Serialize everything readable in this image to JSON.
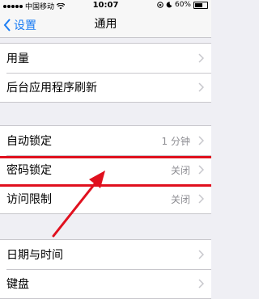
{
  "status_bar": {
    "carrier": "中国移动",
    "time": "10:07",
    "battery": "60%"
  },
  "nav": {
    "back_label": "设置",
    "title": "通用"
  },
  "groups": [
    [
      {
        "label": "用量",
        "value": ""
      },
      {
        "label": "后台应用程序刷新",
        "value": ""
      }
    ],
    [
      {
        "label": "自动锁定",
        "value": "1 分钟"
      },
      {
        "label": "密码锁定",
        "value": "关闭"
      },
      {
        "label": "访问限制",
        "value": "关闭"
      }
    ],
    [
      {
        "label": "日期与时间",
        "value": ""
      },
      {
        "label": "键盘",
        "value": ""
      }
    ]
  ],
  "colors": {
    "accent": "#1a7cf4",
    "highlight": "#e0101e",
    "background": "#efeff4"
  }
}
